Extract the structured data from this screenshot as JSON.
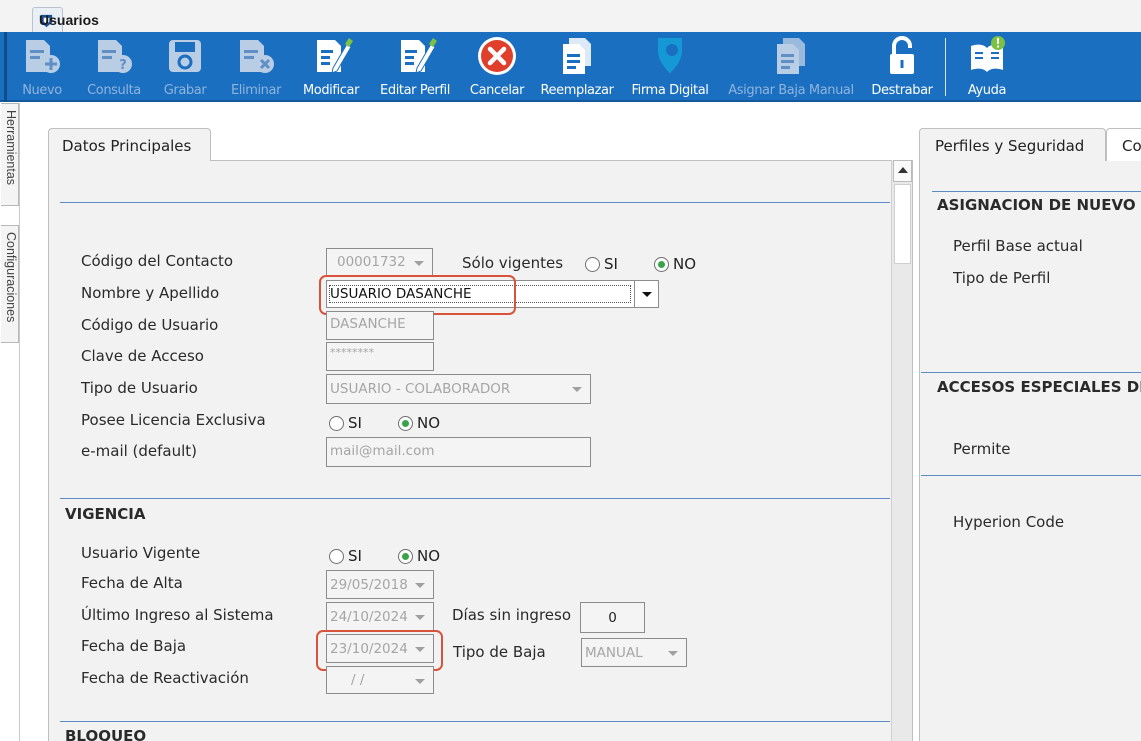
{
  "window": {
    "tab_label": "Usuarios"
  },
  "toolbar": {
    "buttons": [
      {
        "label": "Nuevo",
        "enabled": false,
        "icon": "new-document-icon"
      },
      {
        "label": "Consulta",
        "enabled": false,
        "icon": "query-document-icon"
      },
      {
        "label": "Grabar",
        "enabled": false,
        "icon": "save-disk-icon"
      },
      {
        "label": "Eliminar",
        "enabled": false,
        "icon": "delete-document-icon"
      },
      {
        "label": "Modificar",
        "enabled": true,
        "icon": "edit-pencil-icon"
      },
      {
        "label": "Editar Perfil",
        "enabled": true,
        "icon": "edit-profile-icon"
      },
      {
        "label": "Cancelar",
        "enabled": true,
        "icon": "cancel-icon"
      },
      {
        "label": "Reemplazar",
        "enabled": true,
        "icon": "replace-icon"
      },
      {
        "label": "Firma Digital",
        "enabled": true,
        "icon": "digital-signature-icon"
      },
      {
        "label": "Asignar Baja Manual",
        "enabled": false,
        "icon": "manual-removal-icon"
      },
      {
        "label": "Destrabar",
        "enabled": true,
        "icon": "unlock-icon"
      },
      {
        "label": "Ayuda",
        "enabled": true,
        "icon": "help-book-icon"
      }
    ]
  },
  "side_tabs": {
    "tools": "Herramientas",
    "config": "Configuraciones"
  },
  "main": {
    "tab_label": "Datos Principales",
    "fields": {
      "codigo_contacto": {
        "label": "Código del Contacto",
        "value": "00001732"
      },
      "solo_vigentes": {
        "label": "Sólo vigentes",
        "yes": "SI",
        "no": "NO",
        "selected": "NO"
      },
      "nombre": {
        "label": "Nombre y Apellido",
        "value": "USUARIO DASANCHE"
      },
      "codigo_usuario": {
        "label": "Código de Usuario",
        "value": "DASANCHE"
      },
      "clave": {
        "label": "Clave de Acceso",
        "value": "********"
      },
      "tipo_usuario": {
        "label": "Tipo de Usuario",
        "value": "USUARIO - COLABORADOR"
      },
      "licencia": {
        "label": "Posee Licencia Exclusiva",
        "yes": "SI",
        "no": "NO",
        "selected": "NO"
      },
      "email": {
        "label": "e-mail (default)",
        "value": "mail@mail.com"
      }
    },
    "vigencia": {
      "title": "VIGENCIA",
      "usuario_vigente": {
        "label": "Usuario Vigente",
        "yes": "SI",
        "no": "NO",
        "selected": "NO"
      },
      "fecha_alta": {
        "label": "Fecha de Alta",
        "value": "29/05/2018"
      },
      "ultimo_ingreso": {
        "label": "Último Ingreso al Sistema",
        "value": "24/10/2024"
      },
      "dias_sin_ingreso": {
        "label": "Días sin ingreso",
        "value": "0"
      },
      "fecha_baja": {
        "label": "Fecha de Baja",
        "value": "23/10/2024"
      },
      "tipo_baja": {
        "label": "Tipo de Baja",
        "value": "MANUAL"
      },
      "fecha_reactivacion": {
        "label": "Fecha de Reactivación",
        "value": " /  /"
      }
    },
    "bloqueo": {
      "title": "BLOQUEO"
    }
  },
  "right": {
    "tab_label": "Perfiles y Seguridad",
    "tab2_label": "Co",
    "asignacion_title": "ASIGNACION DE NUEVO PE",
    "perfil_base": "Perfil Base actual",
    "tipo_perfil": "Tipo de Perfil",
    "accesos_title": "ACCESOS ESPECIALES DES",
    "permite": "Permite",
    "hyperion": "Hyperion Code"
  },
  "colors": {
    "toolbar_bg": "#1b6fc0",
    "highlight": "#d9533c",
    "radio_selected": "#3aa34a",
    "section_rule": "#5b8bc5"
  }
}
